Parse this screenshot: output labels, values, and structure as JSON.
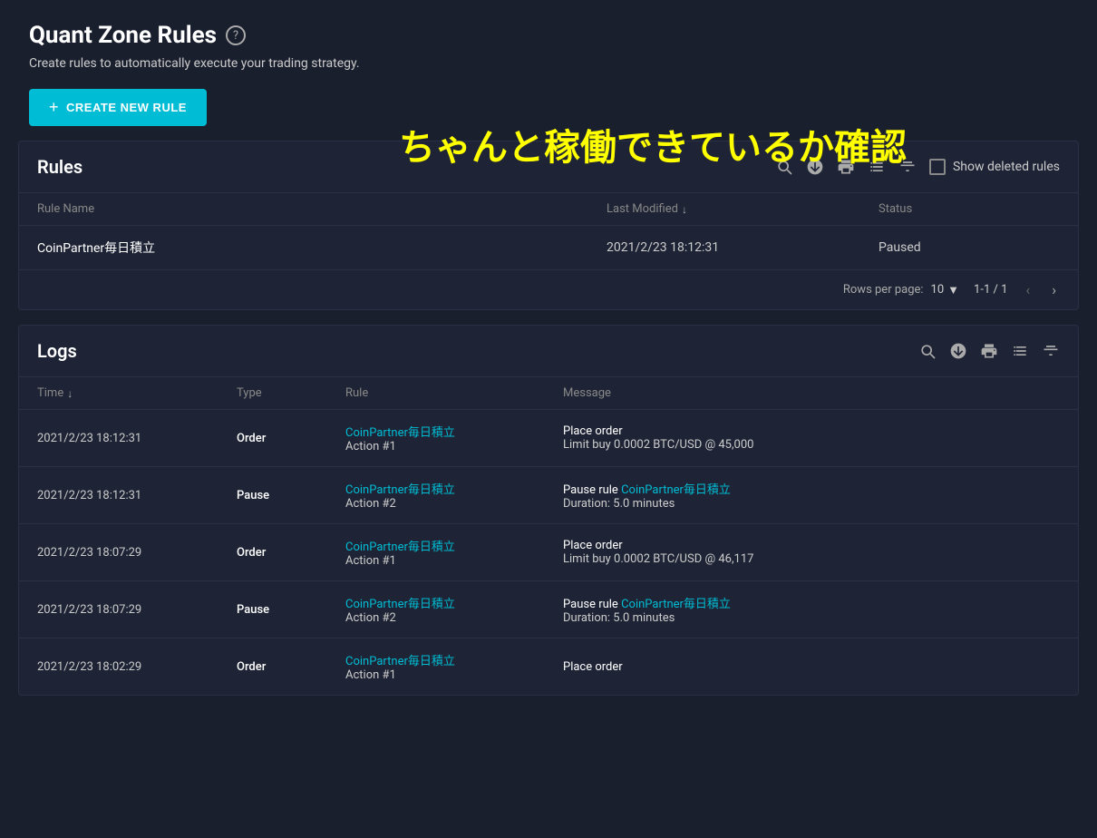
{
  "page": {
    "title": "Quant Zone Rules",
    "subtitle": "Create rules to automatically execute your trading strategy.",
    "create_button": "CREATE NEW RULE",
    "banner_text": "ちゃんと稼働できているか確認"
  },
  "rules_section": {
    "title": "Rules",
    "show_deleted_label": "Show deleted rules",
    "columns": {
      "rule_name": "Rule Name",
      "last_modified": "Last Modified",
      "status": "Status"
    },
    "rows": [
      {
        "rule_name": "CoinPartner毎日積立",
        "last_modified": "2021/2/23 18:12:31",
        "status": "Paused"
      }
    ],
    "footer": {
      "rows_per_page_label": "Rows per page:",
      "rows_per_page_value": "10",
      "pagination": "1-1 / 1"
    }
  },
  "logs_section": {
    "title": "Logs",
    "columns": {
      "time": "Time",
      "type": "Type",
      "rule": "Rule",
      "message": "Message"
    },
    "rows": [
      {
        "time": "2021/2/23 18:12:31",
        "type": "Order",
        "rule_link": "CoinPartner毎日積立",
        "rule_action": "Action #1",
        "message_main": "Place order",
        "message_sub": "Limit buy 0.0002 BTC/USD @ 45,000"
      },
      {
        "time": "2021/2/23 18:12:31",
        "type": "Pause",
        "rule_link": "CoinPartner毎日積立",
        "rule_action": "Action #2",
        "message_main": "Pause rule",
        "message_link": "CoinPartner毎日積立",
        "message_sub": "Duration: 5.0 minutes"
      },
      {
        "time": "2021/2/23 18:07:29",
        "type": "Order",
        "rule_link": "CoinPartner毎日積立",
        "rule_action": "Action #1",
        "message_main": "Place order",
        "message_sub": "Limit buy 0.0002 BTC/USD @ 46,117"
      },
      {
        "time": "2021/2/23 18:07:29",
        "type": "Pause",
        "rule_link": "CoinPartner毎日積立",
        "rule_action": "Action #2",
        "message_main": "Pause rule",
        "message_link": "CoinPartner毎日積立",
        "message_sub": "Duration: 5.0 minutes"
      },
      {
        "time": "2021/2/23 18:02:29",
        "type": "Order",
        "rule_link": "CoinPartner毎日積立",
        "rule_action": "Action #1",
        "message_main": "Place order",
        "message_sub": ""
      }
    ]
  },
  "icons": {
    "search": "🔍",
    "download": "⬇",
    "print": "🖨",
    "columns": "⊞",
    "filter": "≡",
    "chevron_down": "▼",
    "chevron_left": "‹",
    "chevron_right": "›"
  }
}
